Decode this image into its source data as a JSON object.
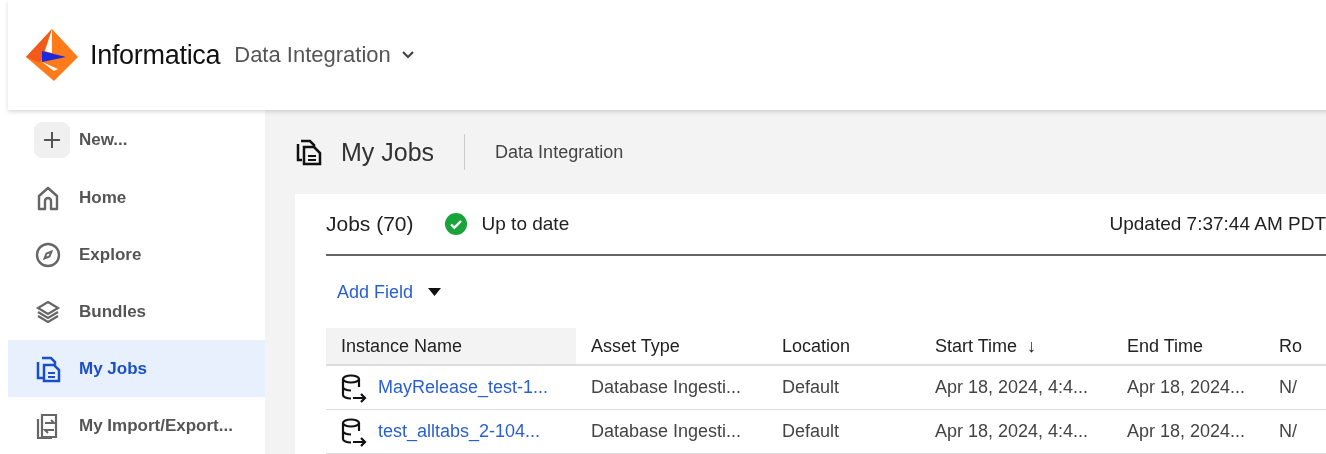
{
  "header": {
    "brand": "Informatica",
    "product": "Data Integration"
  },
  "sidebar": {
    "items": [
      {
        "label": "New...",
        "kind": "new",
        "selected": false
      },
      {
        "label": "Home",
        "kind": "home",
        "selected": false
      },
      {
        "label": "Explore",
        "kind": "explore",
        "selected": false
      },
      {
        "label": "Bundles",
        "kind": "bundles",
        "selected": false
      },
      {
        "label": "My Jobs",
        "kind": "jobs",
        "selected": true
      },
      {
        "label": "My Import/Export...",
        "kind": "import",
        "selected": false
      }
    ]
  },
  "page": {
    "title": "My Jobs",
    "context": "Data Integration"
  },
  "jobs": {
    "title": "Jobs (70)",
    "status": "Up to date",
    "updated": "Updated 7:37:44 AM PDT",
    "add_field": "Add Field"
  },
  "table": {
    "columns": [
      {
        "label": "Instance Name"
      },
      {
        "label": "Asset Type"
      },
      {
        "label": "Location"
      },
      {
        "label": "Start Time",
        "sort_mark": "↓"
      },
      {
        "label": "End Time"
      },
      {
        "label": "Ro"
      }
    ],
    "rows": [
      [
        "MayRelease_test-1...",
        "Database Ingesti...",
        "Default",
        "Apr 18, 2024, 4:4...",
        "Apr 18, 2024...",
        "N/"
      ],
      [
        "test_alltabs_2-104...",
        "Database Ingesti...",
        "Default",
        "Apr 18, 2024, 4:4...",
        "Apr 18, 2024...",
        "N/"
      ]
    ]
  }
}
